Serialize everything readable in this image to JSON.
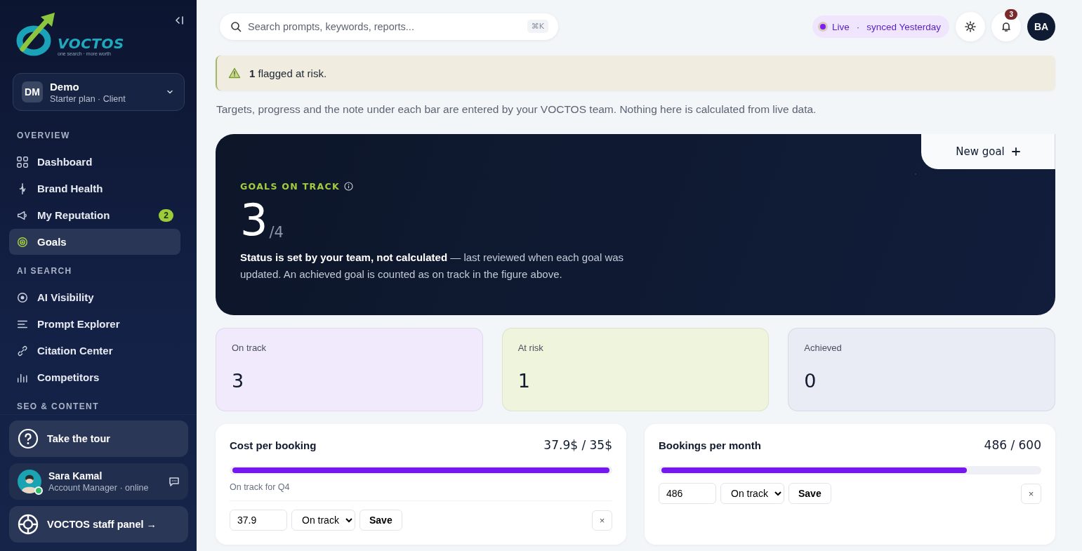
{
  "sidebar": {
    "logo": {
      "name": "VOCTOS",
      "tagline": "one search · more worth"
    },
    "workspace": {
      "initials": "DM",
      "name": "Demo",
      "plan": "Starter plan · Client"
    },
    "sections": [
      {
        "title": "OVERVIEW",
        "items": [
          {
            "label": "Dashboard",
            "selected": false
          },
          {
            "label": "Brand Health",
            "selected": false
          },
          {
            "label": "My Reputation",
            "badge": "2",
            "selected": false
          },
          {
            "label": "Goals",
            "selected": true
          }
        ]
      },
      {
        "title": "AI SEARCH",
        "items": [
          {
            "label": "AI Visibility",
            "selected": false
          },
          {
            "label": "Prompt Explorer",
            "selected": false
          },
          {
            "label": "Citation Center",
            "selected": false
          },
          {
            "label": "Competitors",
            "selected": false
          }
        ]
      },
      {
        "title": "SEO & CONTENT"
      }
    ],
    "tour": "Take the tour",
    "manager": {
      "name": "Sara Kamal",
      "role": "Account Manager · online"
    },
    "staff_panel": "VOCTOS staff panel →"
  },
  "topbar": {
    "search": {
      "placeholder": "Search prompts, keywords, reports...",
      "shortcut": "⌘K"
    },
    "sync": {
      "status": "Live",
      "separator": "·",
      "text": "synced Yesterday"
    },
    "notifications": "3",
    "avatar": "BA"
  },
  "alert": "**1** flagged at risk.",
  "note": "Targets, progress and the note under each bar are entered by your VOCTOS team. Nothing here is calculated from live data.",
  "hero": {
    "label": "GOALS ON TRACK",
    "value": "3",
    "total": "/4",
    "description": "**Status is set by your team, not calculated** — last reviewed when each goal was updated. An achieved goal is counted as on track in the figure above.",
    "action": "New goal"
  },
  "stats": [
    {
      "label": "On track",
      "value": "3",
      "color": "#f1eafd"
    },
    {
      "label": "At risk",
      "value": "1",
      "color": "#eef5dc"
    },
    {
      "label": "Achieved",
      "value": "0",
      "color": "#e9ecf5"
    }
  ],
  "goals": [
    {
      "title": "Cost per booking",
      "reading": "37.9$ / 35$",
      "level": 1,
      "note": "On track for Q4",
      "input": "37.9",
      "status": "On track",
      "save": "Save",
      "remove": "×"
    },
    {
      "title": "Bookings per month",
      "reading": "486 / 600",
      "level": 0.81,
      "input": "486",
      "status": "On track",
      "save": "Save",
      "remove": "×"
    }
  ]
}
